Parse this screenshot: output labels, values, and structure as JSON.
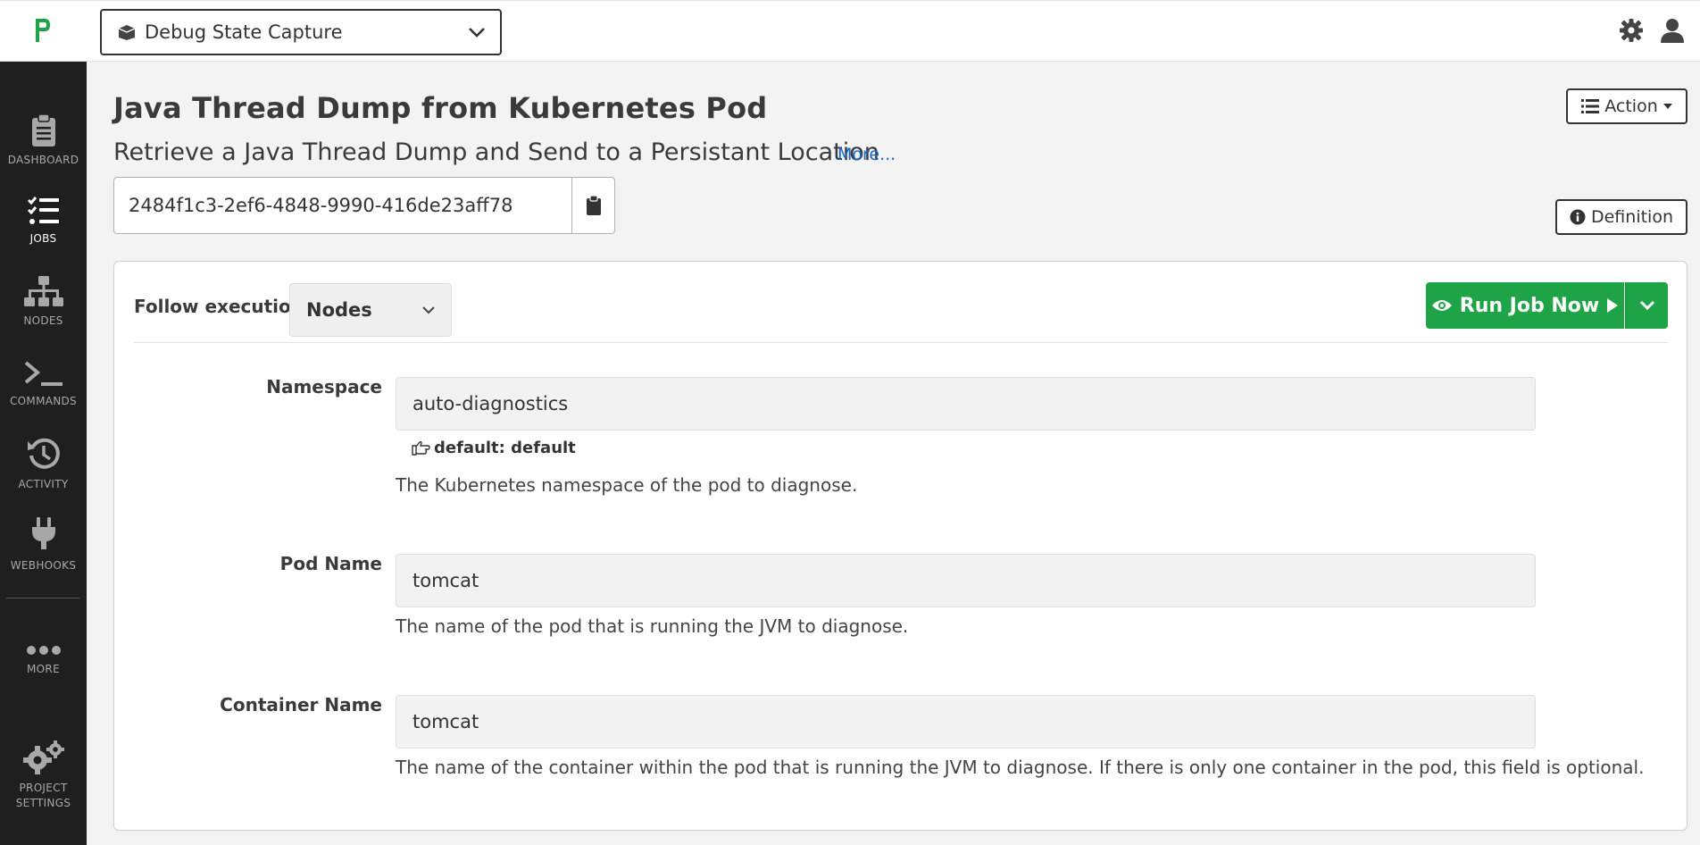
{
  "header": {
    "project_name": "Debug State Capture"
  },
  "sidebar": {
    "items": [
      {
        "label": "DASHBOARD"
      },
      {
        "label": "JOBS"
      },
      {
        "label": "NODES"
      },
      {
        "label": "COMMANDS"
      },
      {
        "label": "ACTIVITY"
      },
      {
        "label": "WEBHOOKS"
      },
      {
        "label": "MORE"
      },
      {
        "label": "PROJECT\nSETTINGS"
      }
    ],
    "active": "JOBS"
  },
  "job": {
    "title": "Java Thread Dump from Kubernetes Pod",
    "description": "Retrieve a Java Thread Dump and Send to a Persistant Location",
    "more_link": "More...",
    "uuid": "2484f1c3-2ef6-4848-9990-416de23aff78",
    "action_label": "Action",
    "definition_label": "Definition"
  },
  "execution": {
    "follow_label": "Follow execution",
    "follow_selected": "Nodes",
    "run_label": "Run Job Now"
  },
  "options": [
    {
      "label": "Namespace",
      "value": "auto-diagnostics",
      "default_text": "default: default",
      "description": "The Kubernetes namespace of the pod to diagnose."
    },
    {
      "label": "Pod Name",
      "value": "tomcat",
      "description": "The name of the pod that is running the JVM to diagnose."
    },
    {
      "label": "Container Name",
      "value": "tomcat",
      "description": "The name of the container within the pod that is running the JVM to diagnose. If there is only one container in the pod, this field is optional."
    }
  ],
  "colors": {
    "brand_green": "#1ea446",
    "sidebar_bg": "#1f1f1f",
    "link_blue": "#1b67c9"
  }
}
